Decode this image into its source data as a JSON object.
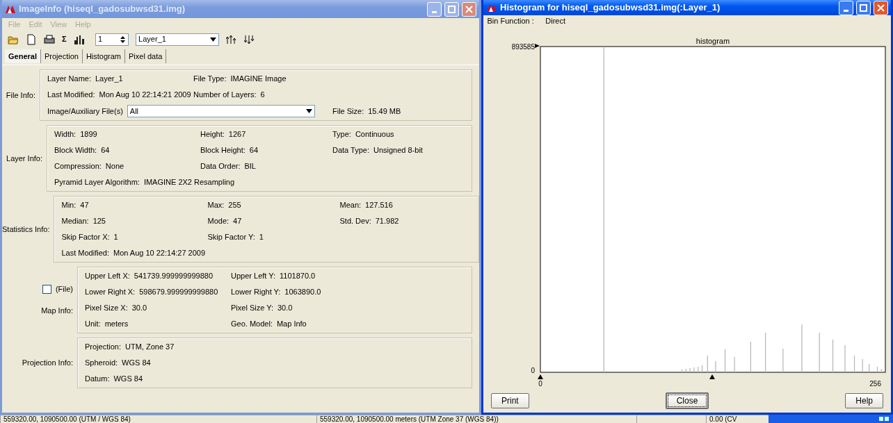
{
  "info_window": {
    "title": "ImageInfo (hiseql_gadosubwsd31.img)",
    "menu": [
      {
        "label": "File",
        "disabled": true
      },
      {
        "label": "Edit",
        "disabled": true
      },
      {
        "label": "View",
        "disabled": true
      },
      {
        "label": "Help",
        "disabled": true
      }
    ],
    "toolbar": {
      "sigma": "Σ",
      "band": "1",
      "layer": "Layer_1"
    },
    "tabs": [
      {
        "label": "General",
        "selected": true
      },
      {
        "label": "Projection",
        "selected": false
      },
      {
        "label": "Histogram",
        "selected": false
      },
      {
        "label": "Pixel data",
        "selected": false
      }
    ],
    "sections": [
      {
        "label": "File Info:",
        "rows": [
          [
            {
              "label": "Layer Name:",
              "value": "Layer_1"
            },
            {
              "label": "File Type:",
              "value": "IMAGINE Image"
            }
          ],
          [
            {
              "label": "Last Modified:",
              "value": "Mon Aug 10 22:14:21 2009"
            },
            {
              "label": "Number of Layers:",
              "value": "6"
            }
          ],
          [
            {
              "label": "Image/Auxiliary File(s)",
              "value": "All",
              "kind": "dropdown"
            },
            {
              "label": "File Size:",
              "value": "15.49 MB"
            }
          ]
        ]
      },
      {
        "label": "Layer Info:",
        "rows": [
          [
            {
              "label": "Width:",
              "value": "1899"
            },
            {
              "label": "Height:",
              "value": "1267"
            },
            {
              "label": "Type:",
              "value": "Continuous"
            }
          ],
          [
            {
              "label": "Block Width:",
              "value": "64"
            },
            {
              "label": "Block Height:",
              "value": "64"
            },
            {
              "label": "Data Type:",
              "value": "Unsigned 8-bit"
            }
          ],
          [
            {
              "label": "Compression:",
              "value": "None"
            },
            {
              "label": "Data Order:",
              "value": "BIL"
            }
          ],
          [
            {
              "label": "Pyramid Layer Algorithm:",
              "value": "IMAGINE 2X2 Resampling"
            }
          ]
        ]
      },
      {
        "label": "Statistics Info:",
        "rows": [
          [
            {
              "label": "Min:",
              "value": "47"
            },
            {
              "label": "Max:",
              "value": "255"
            },
            {
              "label": "Mean:",
              "value": "127.516"
            }
          ],
          [
            {
              "label": "Median:",
              "value": "125"
            },
            {
              "label": "Mode:",
              "value": "47"
            },
            {
              "label": "Std. Dev:",
              "value": "71.982"
            }
          ],
          [
            {
              "label": "Skip Factor X:",
              "value": "1"
            },
            {
              "label": "Skip Factor Y:",
              "value": "1"
            }
          ],
          [
            {
              "label": "Last Modified:",
              "value": "Mon Aug 10 22:14:27 2009"
            }
          ]
        ]
      },
      {
        "label": "Map Info:",
        "checkbox": {
          "label": "(File)",
          "checked": false
        },
        "rows": [
          [
            {
              "label": "Upper Left X:",
              "value": "541739.999999999880"
            },
            {
              "label": "Upper Left Y:",
              "value": "1101870.0"
            }
          ],
          [
            {
              "label": "Lower Right X:",
              "value": "598679.999999999880"
            },
            {
              "label": "Lower Right Y:",
              "value": "1063890.0"
            }
          ],
          [
            {
              "label": "Pixel Size X:",
              "value": "30.0"
            },
            {
              "label": "Pixel Size Y:",
              "value": "30.0"
            }
          ],
          [
            {
              "label": "Unit:",
              "value": "meters"
            },
            {
              "label": "Geo. Model:",
              "value": "Map Info"
            }
          ]
        ]
      },
      {
        "label": "Projection Info:",
        "rows": [
          [
            {
              "label": "Projection:",
              "value": "UTM, Zone 37"
            }
          ],
          [
            {
              "label": "Spheroid:",
              "value": "WGS 84"
            }
          ],
          [
            {
              "label": "Datum:",
              "value": "WGS 84"
            }
          ]
        ]
      }
    ]
  },
  "histogram_window": {
    "title": "Histogram for hiseql_gadosubwsd31.img(:Layer_1)",
    "bin_function_label": "Bin Function :",
    "bin_function": "Direct",
    "plot": {
      "title": "histogram",
      "y_max": "893585",
      "y_min": "0",
      "x_min": "0",
      "x_max": "256"
    },
    "buttons": [
      {
        "label": "Print",
        "focused": false
      },
      {
        "label": "Close",
        "focused": true
      },
      {
        "label": "Help",
        "focused": false
      }
    ]
  },
  "status_bar": [
    "559320.00, 1090500.00   (UTM / WGS 84)",
    "559320.00, 1090500.00 meters (UTM Zone 37 (WGS 84))",
    "0.00 (CV"
  ]
}
